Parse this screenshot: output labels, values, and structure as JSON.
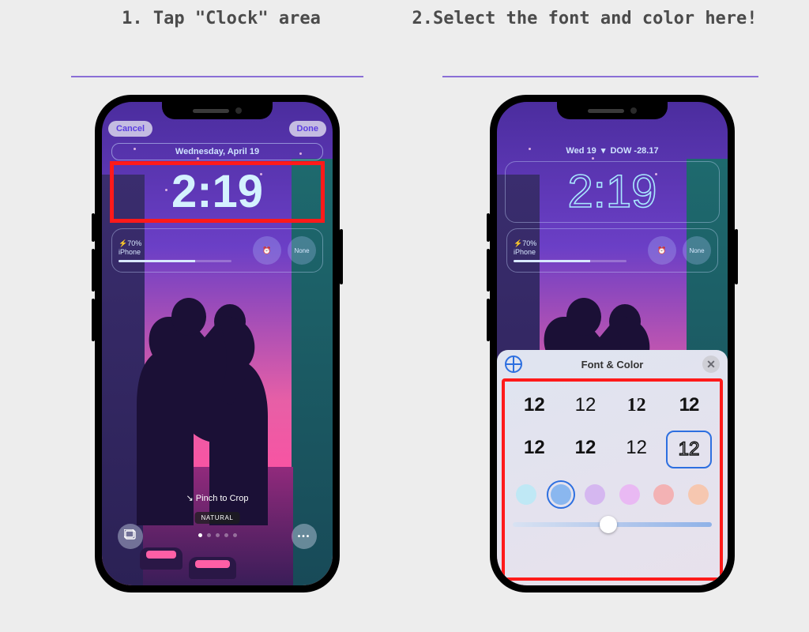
{
  "steps": {
    "s1": "1. Tap \"Clock\" area",
    "s2": "2.Select the font and color here!"
  },
  "accent": "#8a6fd6",
  "screenA": {
    "cancel": "Cancel",
    "done": "Done",
    "date": "Wednesday, April 19",
    "time": "2:19",
    "battery_pct": "70%",
    "battery_device": "iPhone",
    "widget_right_label": "None",
    "pinch": "↘ Pinch to Crop",
    "mode_label": "NATURAL",
    "bottom_more": "•••"
  },
  "screenB": {
    "date": "Wed 19",
    "stock_name": "DOW",
    "stock_change": "-28.17",
    "time": "2:19",
    "battery_pct": "70%",
    "battery_device": "iPhone",
    "widget_right_label": "None",
    "sheet_title": "Font & Color",
    "font_sample": "12",
    "swatches": [
      "#bfe8f5",
      "#8ab7ef",
      "#d5b7f0",
      "#e9b9f3",
      "#f3b2b4",
      "#f6c7b0"
    ],
    "slider_value": 0.48
  }
}
